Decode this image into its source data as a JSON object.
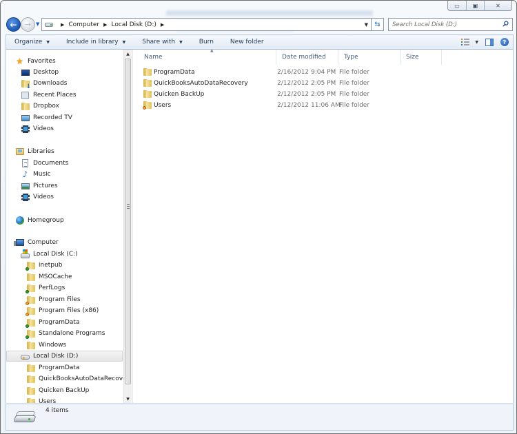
{
  "window": {
    "caption_buttons": [
      {
        "name": "minimize",
        "glyph": "▭"
      },
      {
        "name": "maximize",
        "glyph": "▣"
      },
      {
        "name": "close",
        "glyph": "✕"
      }
    ]
  },
  "navigation": {
    "back_glyph": "←",
    "forward_glyph": "→",
    "history_glyph": "▼",
    "breadcrumb": [
      "Computer",
      "Local Disk (D:)"
    ],
    "separator_glyph": "▶",
    "dropdown_glyph": "▼",
    "refresh_glyph": "⇆"
  },
  "search": {
    "placeholder": "Search Local Disk (D:)",
    "value": ""
  },
  "toolbar": {
    "organize": "Organize",
    "include_in_library": "Include in library",
    "share_with": "Share with",
    "burn": "Burn",
    "new_folder": "New folder",
    "caret": "▼",
    "help_glyph": "?"
  },
  "sidebar": {
    "favorites": {
      "label": "Favorites",
      "items": [
        {
          "label": "Desktop",
          "icon": "desktop-icon"
        },
        {
          "label": "Downloads",
          "icon": "downloads-icon"
        },
        {
          "label": "Recent Places",
          "icon": "recent-places-icon"
        },
        {
          "label": "Dropbox",
          "icon": "folder-icon"
        },
        {
          "label": "Recorded TV",
          "icon": "tv-icon"
        },
        {
          "label": "Videos",
          "icon": "video-icon"
        }
      ]
    },
    "libraries": {
      "label": "Libraries",
      "items": [
        {
          "label": "Documents",
          "icon": "documents-icon"
        },
        {
          "label": "Music",
          "icon": "music-icon"
        },
        {
          "label": "Pictures",
          "icon": "pictures-icon"
        },
        {
          "label": "Videos",
          "icon": "video-icon"
        }
      ]
    },
    "homegroup": {
      "label": "Homegroup"
    },
    "computer": {
      "label": "Computer",
      "drives": [
        {
          "label": "Local Disk (C:)",
          "selected": false,
          "folders": [
            {
              "label": "inetpub",
              "badge": "green"
            },
            {
              "label": "MSOCache",
              "badge": ""
            },
            {
              "label": "PerfLogs",
              "badge": "green"
            },
            {
              "label": "Program Files",
              "badge": "orange"
            },
            {
              "label": "Program Files (x86)",
              "badge": "orange"
            },
            {
              "label": "ProgramData",
              "badge": "green"
            },
            {
              "label": "Standalone Programs",
              "badge": "green"
            },
            {
              "label": "Windows",
              "badge": ""
            }
          ]
        },
        {
          "label": "Local Disk (D:)",
          "selected": true,
          "folders": [
            {
              "label": "ProgramData",
              "badge": ""
            },
            {
              "label": "QuickBooksAutoDataRecovery",
              "badge": ""
            },
            {
              "label": "Quicken BackUp",
              "badge": ""
            },
            {
              "label": "Users",
              "badge": ""
            }
          ]
        }
      ]
    },
    "scroll_up": "▲",
    "scroll_down": "▼"
  },
  "file_list": {
    "columns": [
      "Name",
      "Date modified",
      "Type",
      "Size"
    ],
    "sort_glyph": "▲",
    "rows": [
      {
        "name": "ProgramData",
        "date": "2/16/2012 9:04 PM",
        "type": "File folder",
        "size": "",
        "badge": ""
      },
      {
        "name": "QuickBooksAutoDataRecovery",
        "date": "2/12/2012 2:05 PM",
        "type": "File folder",
        "size": "",
        "badge": ""
      },
      {
        "name": "Quicken BackUp",
        "date": "2/12/2012 2:05 PM",
        "type": "File folder",
        "size": "",
        "badge": ""
      },
      {
        "name": "Users",
        "date": "2/12/2012 11:06 AM",
        "type": "File folder",
        "size": "",
        "badge": "orange"
      }
    ]
  },
  "status": {
    "item_count": "4 items"
  }
}
